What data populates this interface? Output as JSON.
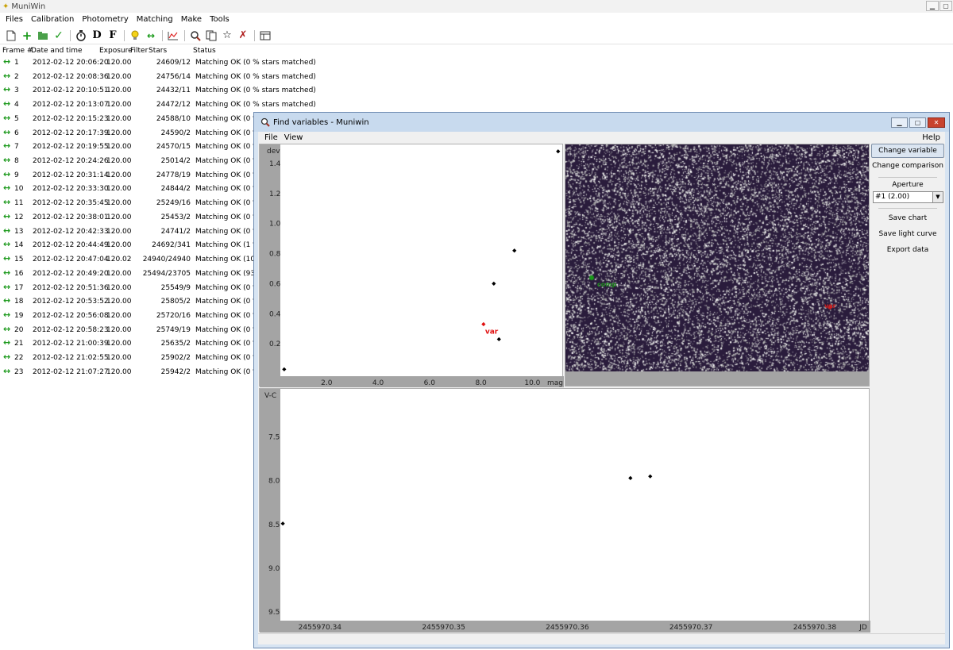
{
  "main": {
    "title": "MuniWin",
    "menu": [
      "Files",
      "Calibration",
      "Photometry",
      "Matching",
      "Make",
      "Tools"
    ],
    "toolbar_icons": [
      "new-file-icon",
      "add-icon",
      "add-folder-icon",
      "check-icon",
      "stopwatch-icon",
      "dark-frame-icon",
      "flat-frame-icon",
      "bulb-icon",
      "match-arrows-icon",
      "chart-icon",
      "find-variables-icon",
      "copy-frames-icon",
      "run-icon",
      "kill-icon",
      "table-icon"
    ],
    "table": {
      "headers": {
        "frame": "Frame #",
        "date": "Date and time",
        "exposure": "Exposure",
        "filter": "Filter",
        "stars": "Stars",
        "status": "Status"
      },
      "rows": [
        {
          "n": "1",
          "date": "2012-02-12 20:06:20",
          "exp": "120.00",
          "stars": "24609/12",
          "status": "Matching OK (0 % stars matched)"
        },
        {
          "n": "2",
          "date": "2012-02-12 20:08:36",
          "exp": "120.00",
          "stars": "24756/14",
          "status": "Matching OK (0 % stars matched)"
        },
        {
          "n": "3",
          "date": "2012-02-12 20:10:51",
          "exp": "120.00",
          "stars": "24432/11",
          "status": "Matching OK (0 % stars matched)"
        },
        {
          "n": "4",
          "date": "2012-02-12 20:13:07",
          "exp": "120.00",
          "stars": "24472/12",
          "status": "Matching OK (0 % stars matched)"
        },
        {
          "n": "5",
          "date": "2012-02-12 20:15:23",
          "exp": "120.00",
          "stars": "24588/10",
          "status": "Matching OK (0 %"
        },
        {
          "n": "6",
          "date": "2012-02-12 20:17:39",
          "exp": "120.00",
          "stars": "24590/2",
          "status": "Matching OK (0 %"
        },
        {
          "n": "7",
          "date": "2012-02-12 20:19:55",
          "exp": "120.00",
          "stars": "24570/15",
          "status": "Matching OK (0 %"
        },
        {
          "n": "8",
          "date": "2012-02-12 20:24:26",
          "exp": "120.00",
          "stars": "25014/2",
          "status": "Matching OK (0 %"
        },
        {
          "n": "9",
          "date": "2012-02-12 20:31:14",
          "exp": "120.00",
          "stars": "24778/19",
          "status": "Matching OK (0 %"
        },
        {
          "n": "10",
          "date": "2012-02-12 20:33:30",
          "exp": "120.00",
          "stars": "24844/2",
          "status": "Matching OK (0 %"
        },
        {
          "n": "11",
          "date": "2012-02-12 20:35:45",
          "exp": "120.00",
          "stars": "25249/16",
          "status": "Matching OK (0 %"
        },
        {
          "n": "12",
          "date": "2012-02-12 20:38:01",
          "exp": "120.00",
          "stars": "25453/2",
          "status": "Matching OK (0 %"
        },
        {
          "n": "13",
          "date": "2012-02-12 20:42:33",
          "exp": "120.00",
          "stars": "24741/2",
          "status": "Matching OK (0 %"
        },
        {
          "n": "14",
          "date": "2012-02-12 20:44:49",
          "exp": "120.00",
          "stars": "24692/341",
          "status": "Matching OK (1 %"
        },
        {
          "n": "15",
          "date": "2012-02-12 20:47:04",
          "exp": "120.02",
          "stars": "24940/24940",
          "status": "Matching OK (100"
        },
        {
          "n": "16",
          "date": "2012-02-12 20:49:20",
          "exp": "120.00",
          "stars": "25494/23705",
          "status": "Matching OK (93 %"
        },
        {
          "n": "17",
          "date": "2012-02-12 20:51:36",
          "exp": "120.00",
          "stars": "25549/9",
          "status": "Matching OK (0 %"
        },
        {
          "n": "18",
          "date": "2012-02-12 20:53:52",
          "exp": "120.00",
          "stars": "25805/2",
          "status": "Matching OK (0 %"
        },
        {
          "n": "19",
          "date": "2012-02-12 20:56:08",
          "exp": "120.00",
          "stars": "25720/16",
          "status": "Matching OK (0 %"
        },
        {
          "n": "20",
          "date": "2012-02-12 20:58:23",
          "exp": "120.00",
          "stars": "25749/19",
          "status": "Matching OK (0 %"
        },
        {
          "n": "21",
          "date": "2012-02-12 21:00:39",
          "exp": "120.00",
          "stars": "25635/2",
          "status": "Matching OK (0 %"
        },
        {
          "n": "22",
          "date": "2012-02-12 21:02:55",
          "exp": "120.00",
          "stars": "25902/2",
          "status": "Matching OK (0 %"
        },
        {
          "n": "23",
          "date": "2012-02-12 21:07:27",
          "exp": "120.00",
          "stars": "25942/2",
          "status": "Matching OK (0 %"
        }
      ]
    }
  },
  "find": {
    "title": "Find variables - Muniwin",
    "menu": [
      "File",
      "View"
    ],
    "help": "Help",
    "side": {
      "change_variable": "Change variable",
      "change_comparison": "Change comparison",
      "aperture_label": "Aperture",
      "aperture_value": "#1 (2.00)",
      "save_chart": "Save chart",
      "save_light_curve": "Save light curve",
      "export_data": "Export data"
    },
    "sky": {
      "var_label": "var",
      "comp_label": "comp"
    }
  },
  "chart_data": [
    {
      "type": "scatter",
      "title": "",
      "xlabel": "mag",
      "ylabel": "dev",
      "xlim": [
        0.2,
        11.1
      ],
      "ylim": [
        0.0,
        1.5
      ],
      "x_ticks": [
        "2.0",
        "4.0",
        "6.0",
        "8.0",
        "10.0"
      ],
      "y_ticks": [
        "0.2",
        "0.4",
        "0.6",
        "0.8",
        "1.0",
        "1.2",
        "1.4"
      ],
      "series": [
        {
          "points": [
            [
              0.35,
              0.03
            ],
            [
              8.7,
              0.23
            ],
            [
              8.5,
              0.6
            ],
            [
              9.3,
              0.82
            ],
            [
              11.0,
              1.48
            ]
          ],
          "color": "#000000"
        },
        {
          "points": [
            [
              8.1,
              0.33
            ]
          ],
          "color": "#e01010",
          "label": "var"
        }
      ]
    },
    {
      "type": "scatter",
      "title": "",
      "xlabel": "JD",
      "ylabel": "V-C",
      "xlim": [
        2455970.3368,
        2455970.3845
      ],
      "ylim": [
        9.6,
        6.95
      ],
      "y_inverted": true,
      "x_ticks": [
        "2455970.34",
        "2455970.35",
        "2455970.36",
        "2455970.37",
        "2455970.38"
      ],
      "y_ticks": [
        "7.5",
        "8.0",
        "8.5",
        "9.0",
        "9.5"
      ],
      "series": [
        {
          "points": [
            [
              2455970.337,
              8.49
            ],
            [
              2455970.3651,
              7.97
            ],
            [
              2455970.3667,
              7.95
            ]
          ],
          "color": "#000000"
        }
      ]
    }
  ]
}
